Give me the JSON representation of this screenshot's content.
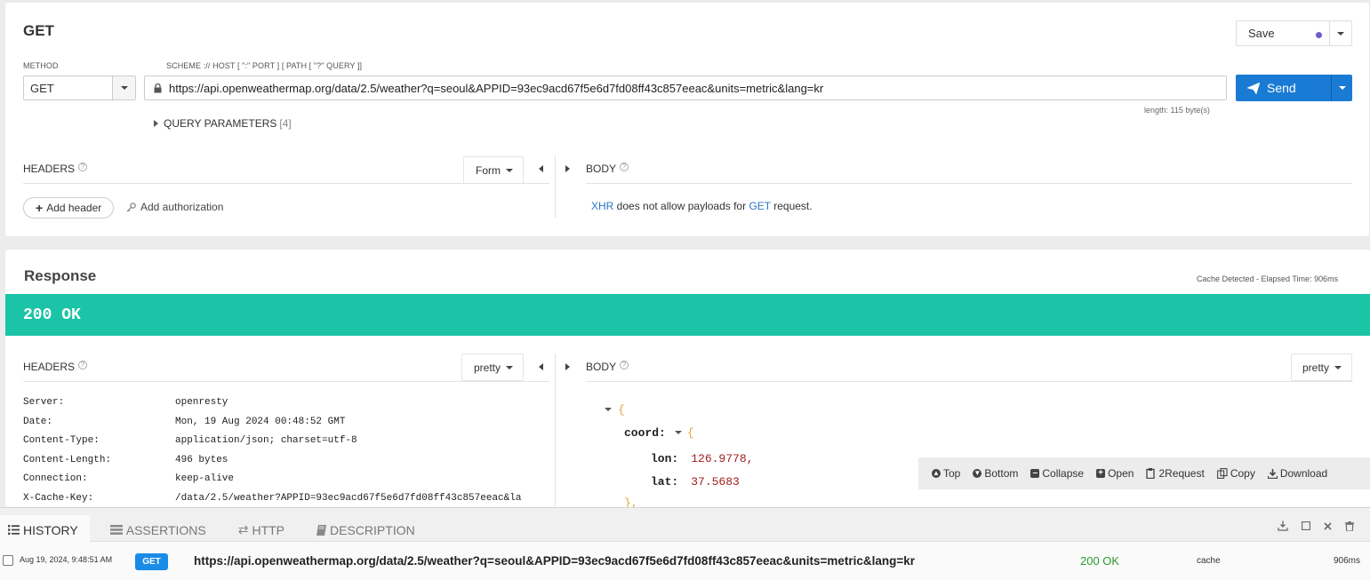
{
  "request": {
    "title": "GET",
    "method_label": "METHOD",
    "method_value": "GET",
    "url_label": "SCHEME :// HOST [ \":\" PORT ] [ PATH [ \"?\" QUERY ]]",
    "url": "https://api.openweathermap.org/data/2.5/weather?q=seoul&APPID=93ec9acd67f5e6d7fd08ff43c857eeac&units=metric&lang=kr",
    "length": "length: 115 byte(s)",
    "save_label": "Save",
    "send_label": "Send",
    "query_params_label": "QUERY PARAMETERS",
    "query_params_count": "[4]",
    "headers_label": "HEADERS",
    "form_label": "Form",
    "add_header_label": "Add header",
    "add_auth_label": "Add authorization",
    "body_label": "BODY",
    "body_msg_xhr": "XHR",
    "body_msg_mid": " does not allow payloads for ",
    "body_msg_get": "GET",
    "body_msg_end": " request."
  },
  "response": {
    "title": "Response",
    "cache_info": "Cache Detected - Elapsed Time: 906ms",
    "status": "200 OK",
    "headers_label": "HEADERS",
    "headers_format": "pretty",
    "body_label": "BODY",
    "body_format": "pretty",
    "headers": [
      {
        "key": "Server:",
        "value": "openresty"
      },
      {
        "key": "Date:",
        "value": "Mon, 19 Aug 2024 00:48:52 GMT"
      },
      {
        "key": "Content-Type:",
        "value": "application/json; charset=utf-8"
      },
      {
        "key": "Content-Length:",
        "value": "496 bytes"
      },
      {
        "key": "Connection:",
        "value": "keep-alive"
      },
      {
        "key": "X-Cache-Key:",
        "value": "/data/2.5/weather?APPID=93ec9acd67f5e6d7fd08ff43c857eeac&la"
      }
    ],
    "json": {
      "open_brace": "{",
      "coord_key": "coord:",
      "coord_open": "{",
      "lon_key": "lon:",
      "lon_value": "126.9778,",
      "lat_key": "lat:",
      "lat_value": "37.5683",
      "close": "},"
    },
    "toolbar": {
      "top": "Top",
      "bottom": "Bottom",
      "collapse": "Collapse",
      "open": "Open",
      "to_request": "2Request",
      "copy": "Copy",
      "download": "Download"
    }
  },
  "bottom_panel": {
    "tabs": [
      {
        "label": "HISTORY",
        "icon": "list-icon"
      },
      {
        "label": "ASSERTIONS",
        "icon": "assertions-icon"
      },
      {
        "label": "HTTP",
        "icon": "exchange-icon"
      },
      {
        "label": "DESCRIPTION",
        "icon": "book-icon"
      }
    ],
    "history_row": {
      "date": "Aug 19, 2024, 9:48:51 AM",
      "method": "GET",
      "url": "https://api.openweathermap.org/data/2.5/weather?q=seoul&APPID=93ec9acd67f5e6d7fd08ff43c857eeac&units=metric&lang=kr",
      "status": "200 OK",
      "source": "cache",
      "time": "906ms"
    }
  },
  "colors": {
    "accent": "#1a7bd4",
    "status_green": "#1bc4a6",
    "json_value": "#a0201f",
    "brace": "#e8a23a",
    "link": "#2a76c6"
  }
}
